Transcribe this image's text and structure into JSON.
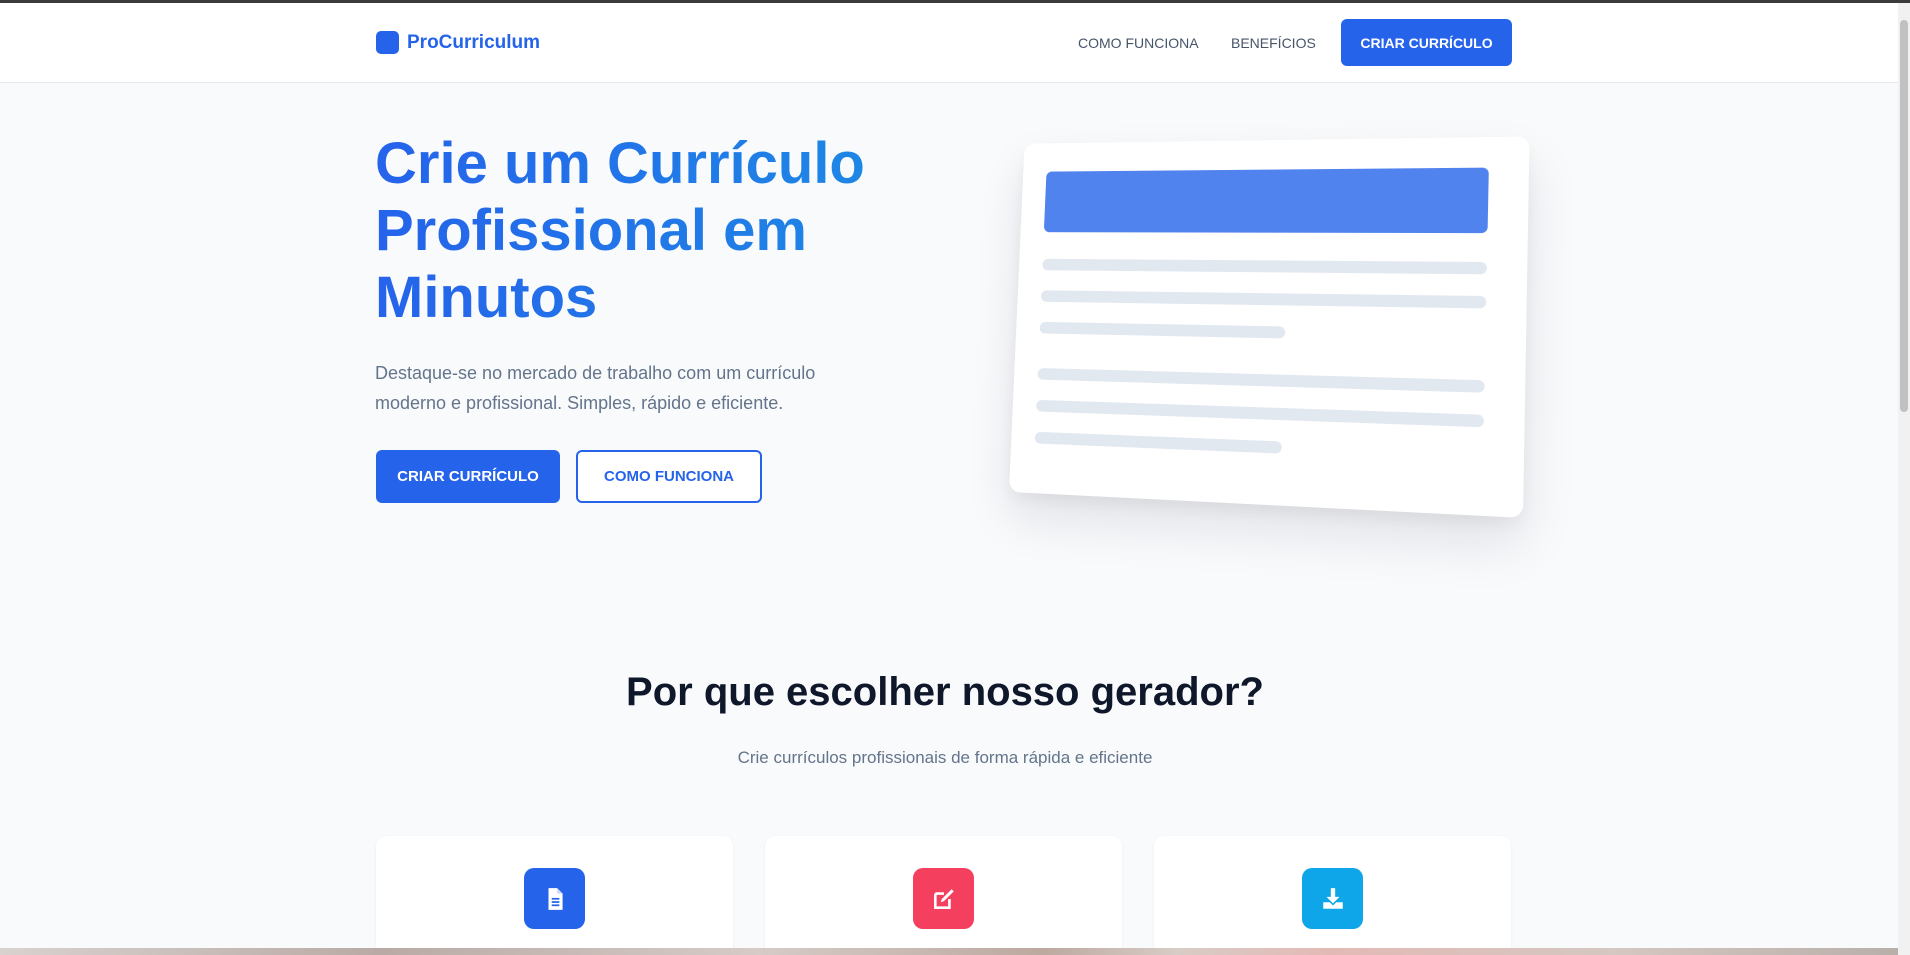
{
  "brand": {
    "name": "ProCurriculum",
    "color": "#2563eb"
  },
  "nav": {
    "how_it_works": "COMO FUNCIONA",
    "benefits": "BENEFÍCIOS",
    "cta": "CRIAR CURRÍCULO"
  },
  "hero": {
    "title": "Crie um Currículo Profissional em Minutos",
    "subtitle": "Destaque-se no mercado de trabalho com um currículo moderno e profissional. Simples, rápido e eficiente.",
    "primary_button": "CRIAR CURRÍCULO",
    "secondary_button": "COMO FUNCIONA"
  },
  "features": {
    "title": "Por que escolher nosso gerador?",
    "subtitle": "Crie currículos profissionais de forma rápida e eficiente",
    "cards": [
      {
        "icon": "document-icon",
        "color": "#2563eb"
      },
      {
        "icon": "edit-icon",
        "color": "#f43f5e"
      },
      {
        "icon": "download-icon",
        "color": "#0ea5e9"
      }
    ]
  }
}
